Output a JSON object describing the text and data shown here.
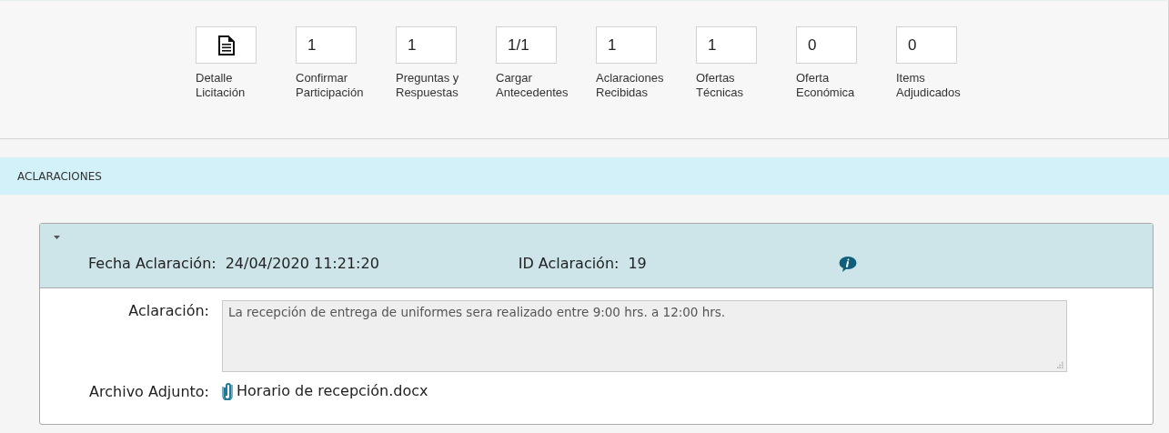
{
  "steps": [
    {
      "kind": "icon",
      "label_lines": [
        "Detalle",
        "Licitación"
      ]
    },
    {
      "kind": "count",
      "value": "1",
      "label_lines": [
        "Confirmar",
        "Participación"
      ]
    },
    {
      "kind": "count",
      "value": "1",
      "label_lines": [
        "Preguntas y",
        "Respuestas"
      ]
    },
    {
      "kind": "count",
      "value": "1/1",
      "label_lines": [
        "Cargar",
        "Antecedentes"
      ]
    },
    {
      "kind": "count",
      "value": "1",
      "label_lines": [
        "Aclaraciones",
        "Recibidas"
      ]
    },
    {
      "kind": "count",
      "value": "1",
      "label_lines": [
        "Ofertas",
        "Técnicas"
      ]
    },
    {
      "kind": "count",
      "value": "0",
      "label_lines": [
        "Oferta",
        "Económica"
      ]
    },
    {
      "kind": "count",
      "value": "0",
      "label_lines": [
        "Items",
        "Adjudicados"
      ]
    }
  ],
  "section": {
    "title": "ACLARACIONES"
  },
  "clarification": {
    "expanded": true,
    "date_label": "Fecha Aclaración:",
    "date": "24/04/2020 11:21:20",
    "id_label": "ID Aclaración:",
    "id": "19",
    "text_label": "Aclaración:",
    "text": "La recepción de entrega de uniformes sera realizado entre 9:00 hrs. a 12:00 hrs.",
    "attachment_label": "Archivo Adjunto:",
    "attachment": "Horario de recepción.docx"
  }
}
